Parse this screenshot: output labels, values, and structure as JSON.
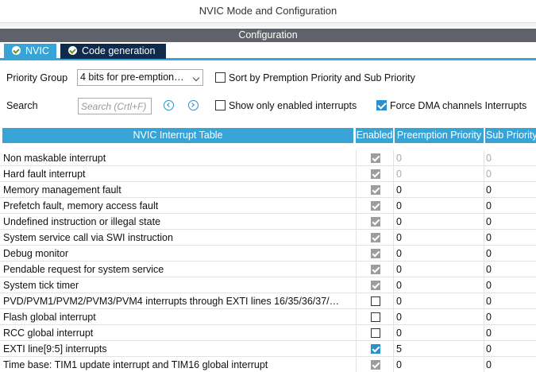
{
  "window": {
    "title": "NVIC Mode and Configuration"
  },
  "config_bar": {
    "label": "Configuration"
  },
  "tabs": [
    {
      "label": "NVIC",
      "active": true
    },
    {
      "label": "Code generation",
      "active": false
    }
  ],
  "priority_group": {
    "label": "Priority Group",
    "value": "4 bits for pre-emption…"
  },
  "sort_option": {
    "label": "Sort by Premption Priority and Sub Priority",
    "checked": false
  },
  "search": {
    "label": "Search",
    "placeholder": "Search (Crtl+F)"
  },
  "show_enabled": {
    "label": "Show only enabled interrupts",
    "checked": false
  },
  "force_dma": {
    "label": "Force DMA channels Interrupts",
    "checked": true
  },
  "colors": {
    "accent": "#38a4d6",
    "tab_dark": "#0f2a4b",
    "config_bar": "#5f6369",
    "check_blue": "#2a8fd0"
  },
  "table": {
    "headers": [
      "NVIC Interrupt Table",
      "Enabled",
      "Preemption Priority",
      "Sub Priority"
    ],
    "rows": [
      {
        "name": "Non maskable interrupt",
        "enabled": "locked",
        "preemption": "0",
        "sub": "0",
        "dim": true
      },
      {
        "name": "Hard fault interrupt",
        "enabled": "locked",
        "preemption": "0",
        "sub": "0",
        "dim": true
      },
      {
        "name": "Memory management fault",
        "enabled": "locked",
        "preemption": "0",
        "sub": "0",
        "dim": false
      },
      {
        "name": "Prefetch fault, memory access fault",
        "enabled": "locked",
        "preemption": "0",
        "sub": "0",
        "dim": false
      },
      {
        "name": "Undefined instruction or illegal state",
        "enabled": "locked",
        "preemption": "0",
        "sub": "0",
        "dim": false
      },
      {
        "name": "System service call via SWI instruction",
        "enabled": "locked",
        "preemption": "0",
        "sub": "0",
        "dim": false
      },
      {
        "name": "Debug monitor",
        "enabled": "locked",
        "preemption": "0",
        "sub": "0",
        "dim": false
      },
      {
        "name": "Pendable request for system service",
        "enabled": "locked",
        "preemption": "0",
        "sub": "0",
        "dim": false
      },
      {
        "name": "System tick timer",
        "enabled": "locked",
        "preemption": "0",
        "sub": "0",
        "dim": false
      },
      {
        "name": "PVD/PVM1/PVM2/PVM3/PVM4 interrupts through EXTI lines 16/35/36/37/…",
        "enabled": "off",
        "preemption": "0",
        "sub": "0",
        "dim": false
      },
      {
        "name": "Flash global interrupt",
        "enabled": "off",
        "preemption": "0",
        "sub": "0",
        "dim": false
      },
      {
        "name": "RCC global interrupt",
        "enabled": "off",
        "preemption": "0",
        "sub": "0",
        "dim": false
      },
      {
        "name": "EXTI line[9:5] interrupts",
        "enabled": "on",
        "preemption": "5",
        "sub": "0",
        "dim": false
      },
      {
        "name": "Time base: TIM1 update interrupt and TIM16 global interrupt",
        "enabled": "locked",
        "preemption": "0",
        "sub": "0",
        "dim": false
      }
    ]
  }
}
